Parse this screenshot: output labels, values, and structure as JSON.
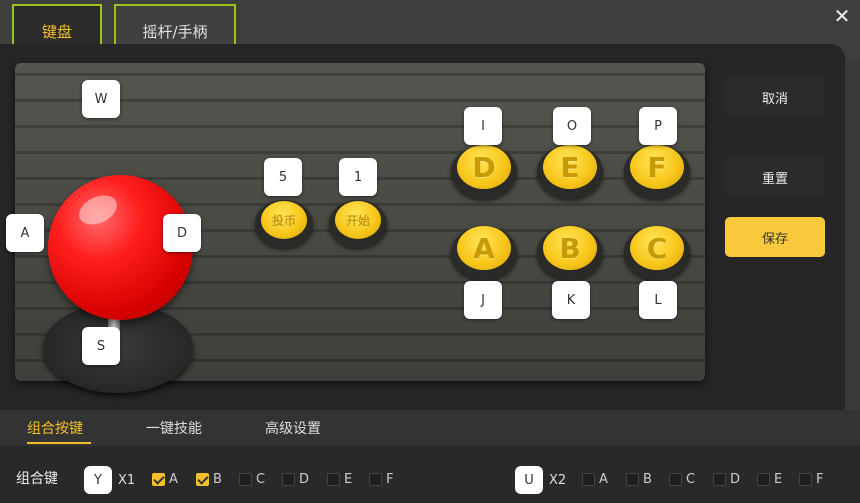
{
  "tabs": {
    "keyboard": "键盘",
    "joystick": "摇杆/手柄"
  },
  "close_icon": "close-icon",
  "arcade": {
    "direction_keys": {
      "up": "W",
      "left": "A",
      "right": "D",
      "down": "S"
    },
    "coin": {
      "key": "5",
      "label": "投币"
    },
    "start": {
      "key": "1",
      "label": "开始"
    },
    "buttons_top": [
      {
        "key": "I",
        "label": "D"
      },
      {
        "key": "O",
        "label": "E"
      },
      {
        "key": "P",
        "label": "F"
      }
    ],
    "buttons_bottom": [
      {
        "key": "J",
        "label": "A"
      },
      {
        "key": "K",
        "label": "B"
      },
      {
        "key": "L",
        "label": "C"
      }
    ]
  },
  "actions": {
    "cancel": "取消",
    "reset": "重置",
    "save": "保存"
  },
  "subtabs": [
    "组合按键",
    "一键技能",
    "高级设置"
  ],
  "combo": {
    "label": "组合键",
    "groups": [
      {
        "key": "Y",
        "multiplier": "X1",
        "options": [
          {
            "label": "A",
            "checked": true
          },
          {
            "label": "B",
            "checked": true
          },
          {
            "label": "C",
            "checked": false
          },
          {
            "label": "D",
            "checked": false
          },
          {
            "label": "E",
            "checked": false
          },
          {
            "label": "F",
            "checked": false
          }
        ]
      },
      {
        "key": "U",
        "multiplier": "X2",
        "options": [
          {
            "label": "A",
            "checked": false
          },
          {
            "label": "B",
            "checked": false
          },
          {
            "label": "C",
            "checked": false
          },
          {
            "label": "D",
            "checked": false
          },
          {
            "label": "E",
            "checked": false
          },
          {
            "label": "F",
            "checked": false
          }
        ]
      }
    ]
  },
  "colors": {
    "accent": "#f4c12c",
    "tab_border": "#9bc41a",
    "ball": "#ff1e1e",
    "button": "#f8c71b"
  }
}
